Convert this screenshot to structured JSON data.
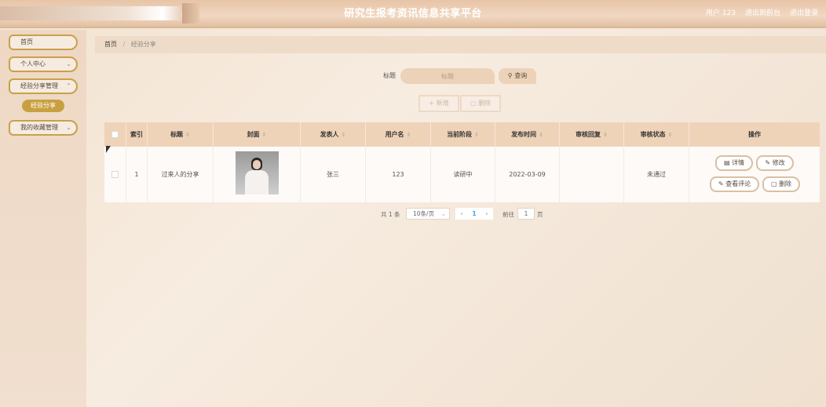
{
  "header": {
    "title": "研究生报考资讯信息共享平台",
    "user": "用户 123",
    "back_to_front": "退出到前台",
    "logout": "退出登录"
  },
  "sidebar": {
    "items": [
      {
        "label": "首页",
        "has_children": false
      },
      {
        "label": "个人中心",
        "has_children": true
      },
      {
        "label": "经验分享管理",
        "has_children": true
      },
      {
        "label": "我的收藏管理",
        "has_children": true
      }
    ],
    "sub_item": "经验分享"
  },
  "breadcrumb": {
    "home": "首页",
    "separator": "/",
    "current": "经验分享"
  },
  "search": {
    "label": "标题",
    "placeholder": "标题",
    "button": "查询",
    "button_icon": "search-icon"
  },
  "actions": {
    "add": "+ 新增",
    "delete": "删除"
  },
  "table": {
    "headers": [
      "索引",
      "标题",
      "封面",
      "发表人",
      "用户名",
      "当前阶段",
      "发布时间",
      "审核回复",
      "审核状态",
      "操作"
    ],
    "rows": [
      {
        "index": "1",
        "title": "过来人的分享",
        "publisher": "张三",
        "username": "123",
        "stage": "读研中",
        "publish_time": "2022-03-09",
        "review_reply": "",
        "review_status": "未通过"
      }
    ],
    "ops": {
      "detail": "详情",
      "edit": "修改",
      "view_comments": "查看评论",
      "delete": "删除"
    }
  },
  "pagination": {
    "total": "共 1 条",
    "page_size": "10条/页",
    "current_page": "1",
    "goto_label": "前往",
    "goto_value": "1",
    "goto_suffix": "页"
  },
  "colors": {
    "accent": "#c8a040",
    "header_bg": "#e7c4a6",
    "table_header_bg": "#efd3b8"
  }
}
